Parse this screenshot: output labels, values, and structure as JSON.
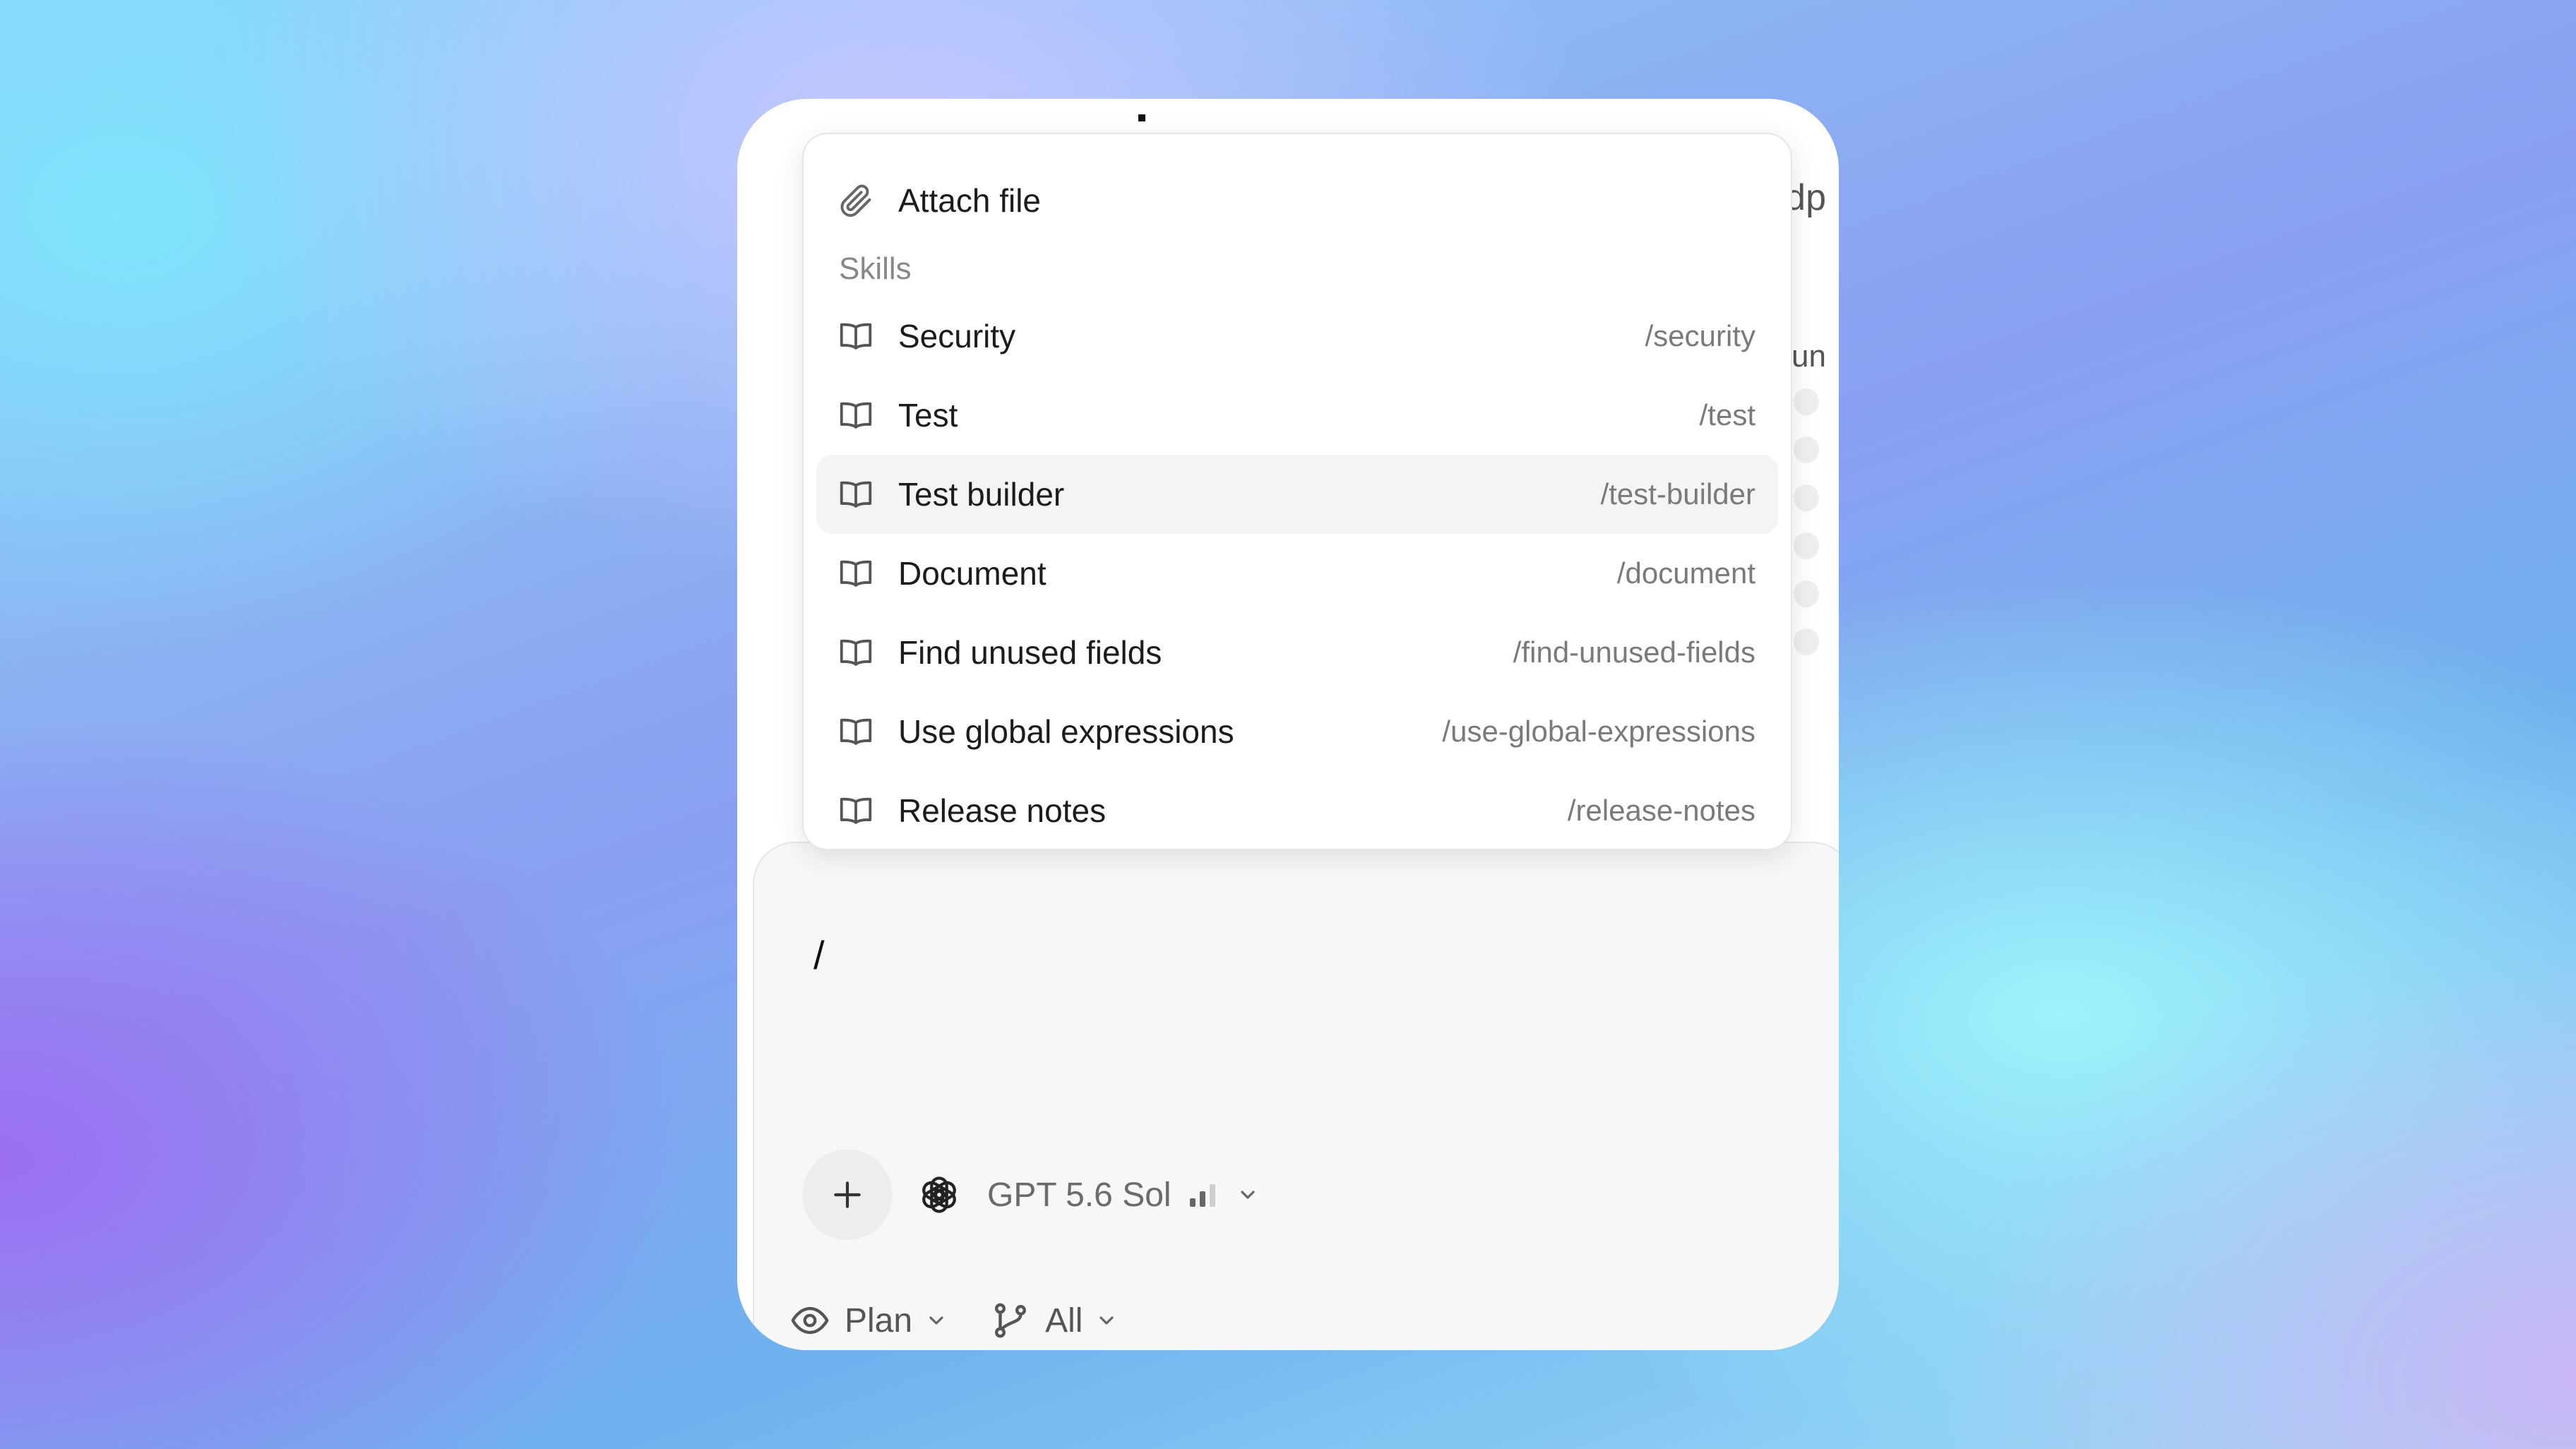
{
  "dropdown": {
    "attach": {
      "label": "Attach file",
      "icon": "paperclip-icon"
    },
    "section_label": "Skills",
    "skills": [
      {
        "label": "Security",
        "command": "/security",
        "icon": "book-icon"
      },
      {
        "label": "Test",
        "command": "/test",
        "icon": "book-icon"
      },
      {
        "label": "Test builder",
        "command": "/test-builder",
        "icon": "book-icon",
        "highlighted": true
      },
      {
        "label": "Document",
        "command": "/document",
        "icon": "book-icon"
      },
      {
        "label": "Find unused fields",
        "command": "/find-unused-fields",
        "icon": "book-icon"
      },
      {
        "label": "Use global expressions",
        "command": "/use-global-expressions",
        "icon": "book-icon"
      },
      {
        "label": "Release notes",
        "command": "/release-notes",
        "icon": "book-icon"
      }
    ]
  },
  "composer": {
    "input_value": "/",
    "add_icon": "plus-icon",
    "model": {
      "name": "GPT 5.6 Sol",
      "icon": "openai-logo-icon",
      "strength_level": 2,
      "strength_max": 3
    }
  },
  "footer": {
    "mode": {
      "label": "Plan",
      "icon": "eye-icon"
    },
    "branch": {
      "label": "All",
      "icon": "git-branch-icon"
    }
  },
  "background_text": {
    "line1": "dp",
    "line2": "un"
  },
  "colors": {
    "text": "#1c1c1c",
    "muted": "#7a7a7a",
    "highlight": "#f4f4f4",
    "composer_bg": "#f7f7f7"
  }
}
